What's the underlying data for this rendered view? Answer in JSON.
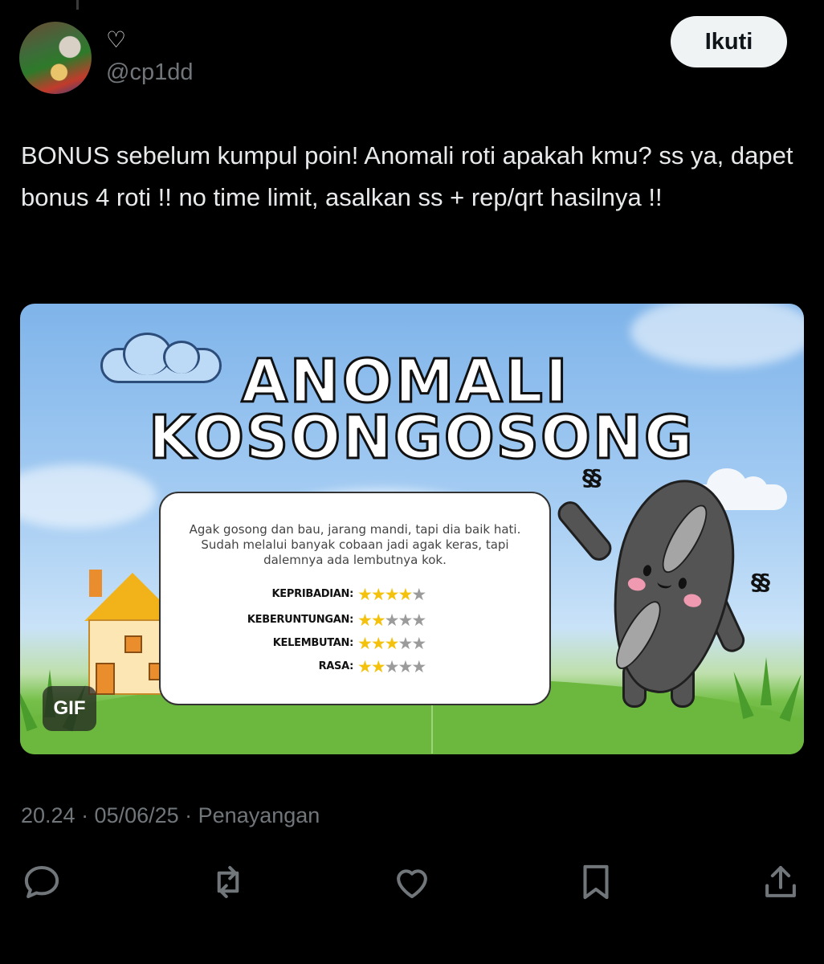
{
  "user": {
    "handle": "@cp1dd",
    "follow_label": "Ikuti"
  },
  "tweet": {
    "text": "BONUS sebelum kumpul poin! Anomali roti apakah kmu? ss ya, dapet bonus 4 roti !! no time limit, asalkan ss + rep/qrt hasilnya !!"
  },
  "media": {
    "badge": "GIF",
    "title_line1": "ANOMALI",
    "title_line2": "KOSONGOSONG",
    "description": "Agak gosong dan bau, jarang mandi, tapi dia baik hati. Sudah melalui banyak cobaan jadi agak keras, tapi dalemnya ada lembutnya kok.",
    "stats": [
      {
        "label": "KEPRIBADIAN:",
        "rating": 4,
        "max": 5
      },
      {
        "label": "KEBERUNTUNGAN:",
        "rating": 2,
        "max": 5
      },
      {
        "label": "KELEMBUTAN:",
        "rating": 3,
        "max": 5
      },
      {
        "label": "RASA:",
        "rating": 2,
        "max": 5
      }
    ]
  },
  "meta": {
    "text": "20.24 · 05/06/25 · Penayangan"
  },
  "actions": [
    "reply-icon",
    "repost-icon",
    "like-icon",
    "bookmark-icon",
    "share-icon"
  ],
  "colors": {
    "background": "#000000",
    "text": "#e7e9ea",
    "muted": "#71767b",
    "follow_button": "#eff3f4",
    "star_on": "#f4c20d",
    "star_off": "#9b9b9b"
  }
}
